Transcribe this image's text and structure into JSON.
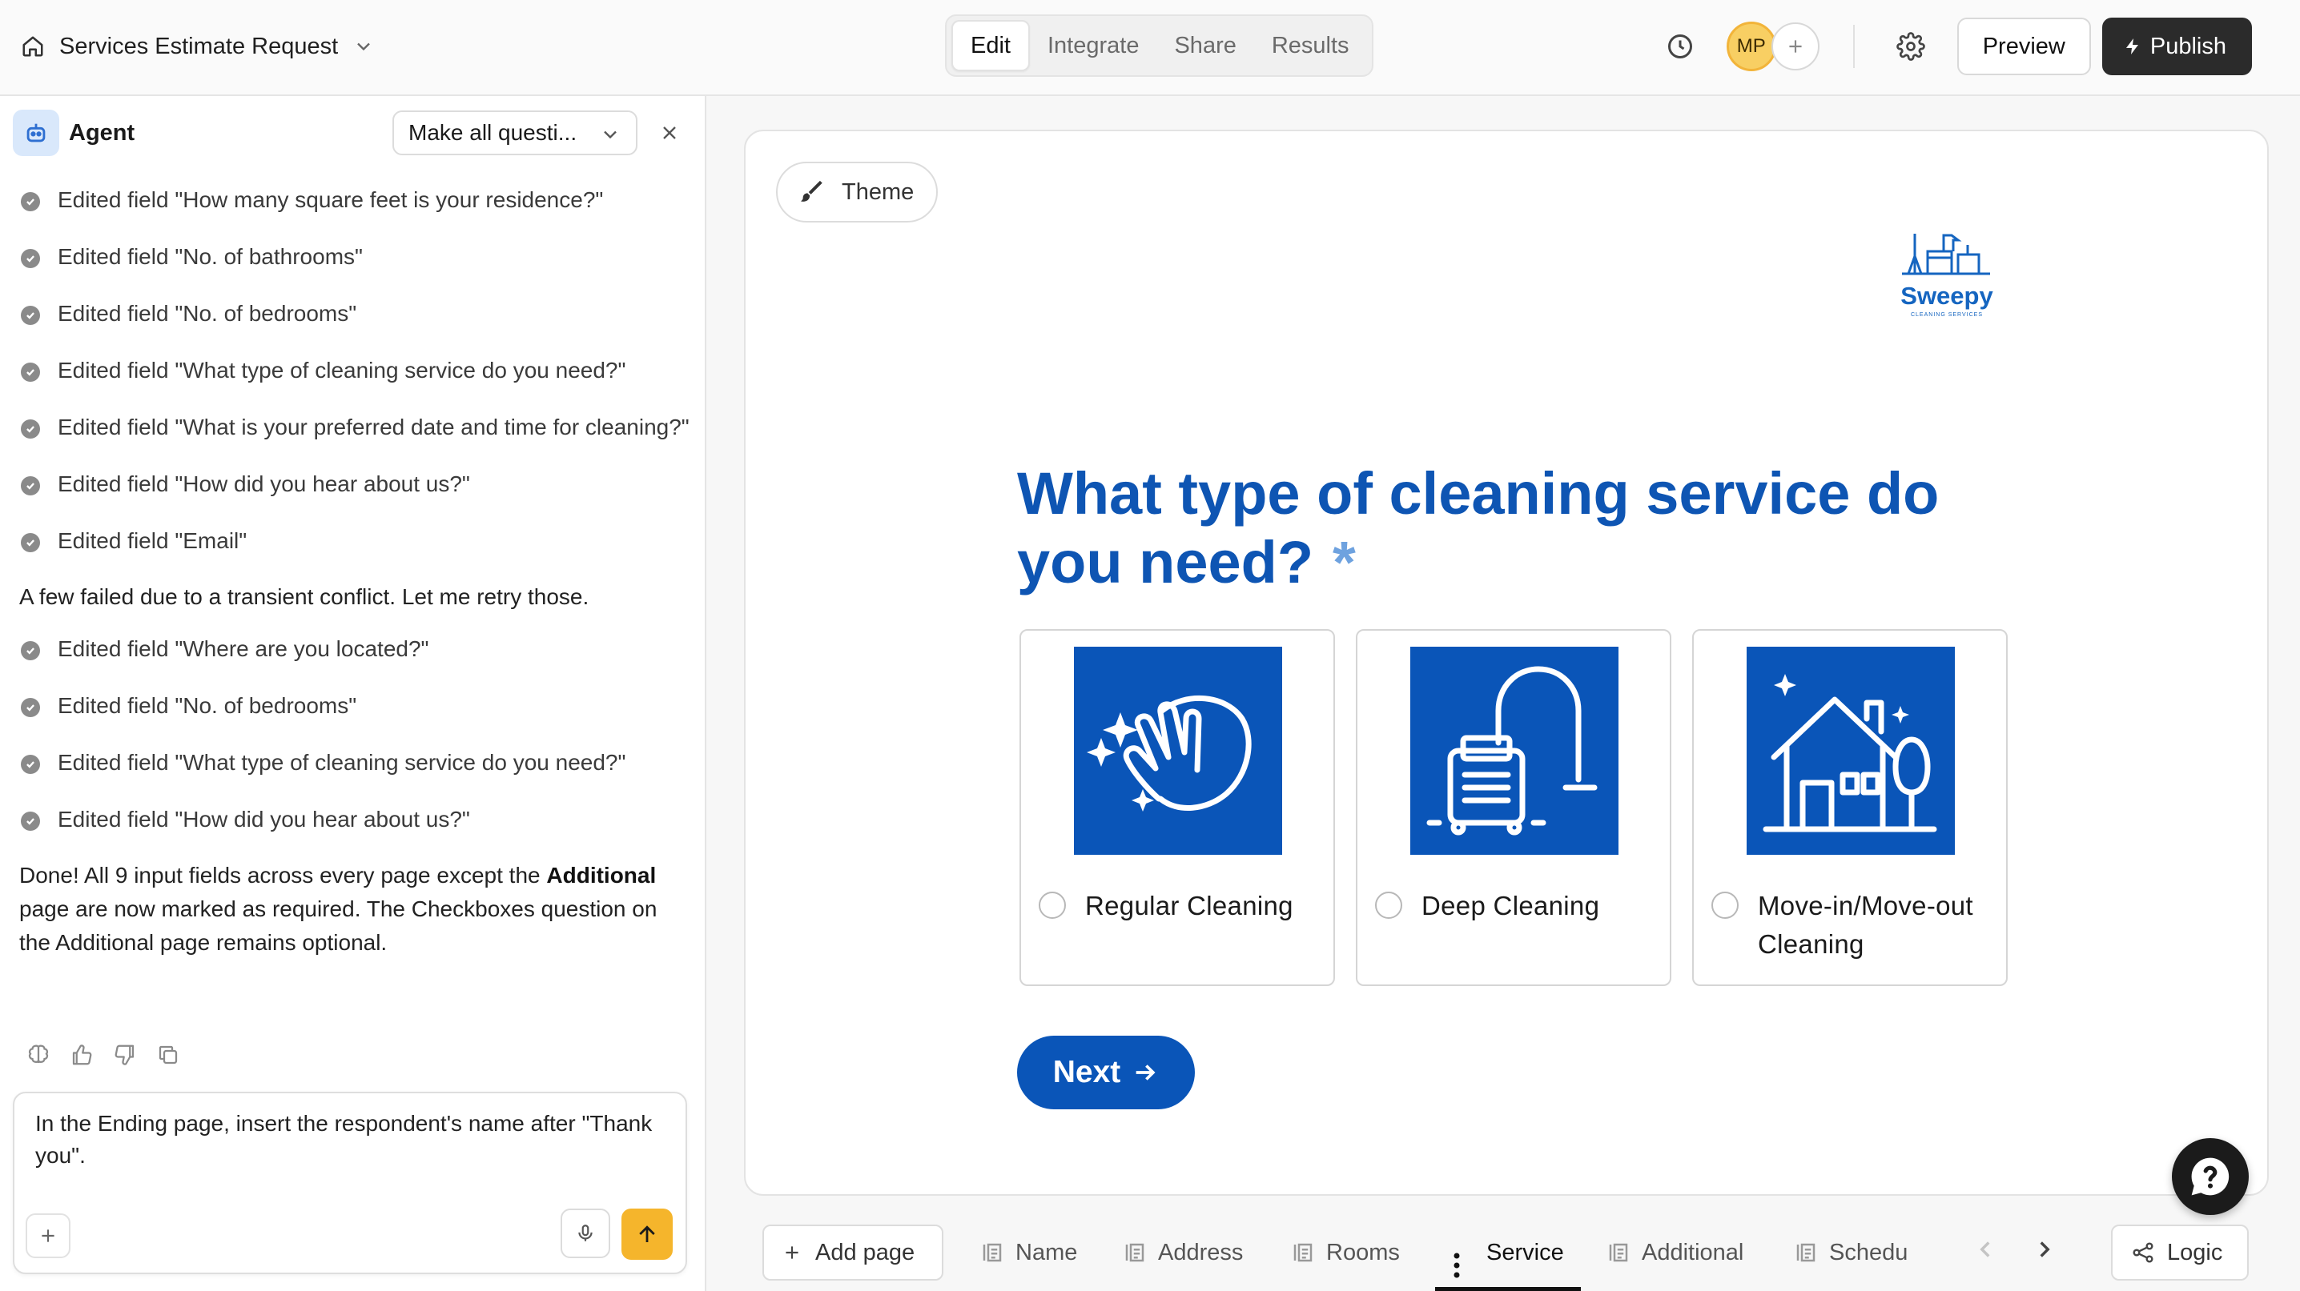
{
  "header": {
    "form_title": "Services Estimate Request",
    "tabs": [
      {
        "label": "Edit",
        "active": true
      },
      {
        "label": "Integrate",
        "active": false
      },
      {
        "label": "Share",
        "active": false
      },
      {
        "label": "Results",
        "active": false
      }
    ],
    "avatar_initials": "MP",
    "preview_label": "Preview",
    "publish_label": "Publish"
  },
  "agent": {
    "title": "Agent",
    "mode_select": "Make all questi...",
    "messages": [
      "Edited field \"How many square feet is your residence?\"",
      "Edited field \"No. of bathrooms\"",
      "Edited field \"No. of bedrooms\"",
      "Edited field \"What type of cleaning service do you need?\"",
      "Edited field \"What is your preferred date and time for cleaning?\"",
      "Edited field \"How did you hear about us?\"",
      "Edited field \"Email\""
    ],
    "retry_note": "A few failed due to a transient conflict. Let me retry those.",
    "retry_messages": [
      "Edited field \"Where are you located?\"",
      "Edited field \"No. of bedrooms\"",
      "Edited field \"What type of cleaning service do you need?\"",
      "Edited field \"How did you hear about us?\""
    ],
    "summary_before": "Done! All 9 input fields across every page except the ",
    "summary_bold": "Additional",
    "summary_after": " page are now marked as required. The Checkboxes question on the Additional page remains optional.",
    "composer_text": "In the Ending page, insert the respondent's name after \"Thank you\"."
  },
  "form": {
    "theme_label": "Theme",
    "logo_name": "Sweepy",
    "logo_tagline": "CLEANING SERVICES",
    "question": "What type of cleaning service do you need?",
    "required_mark": "*",
    "choices": [
      {
        "label": "Regular Cleaning",
        "icon": "cleaning-hand-icon"
      },
      {
        "label": "Deep Cleaning",
        "icon": "vacuum-icon"
      },
      {
        "label": "Move-in/Move-out Cleaning",
        "icon": "house-icon"
      }
    ],
    "next_label": "Next",
    "brand_color": "#0a55b8"
  },
  "pages": {
    "add_page_label": "Add page",
    "tabs": [
      "Name",
      "Address",
      "Rooms",
      "Service",
      "Additional",
      "Schedu"
    ],
    "active": "Service",
    "logic_label": "Logic"
  }
}
